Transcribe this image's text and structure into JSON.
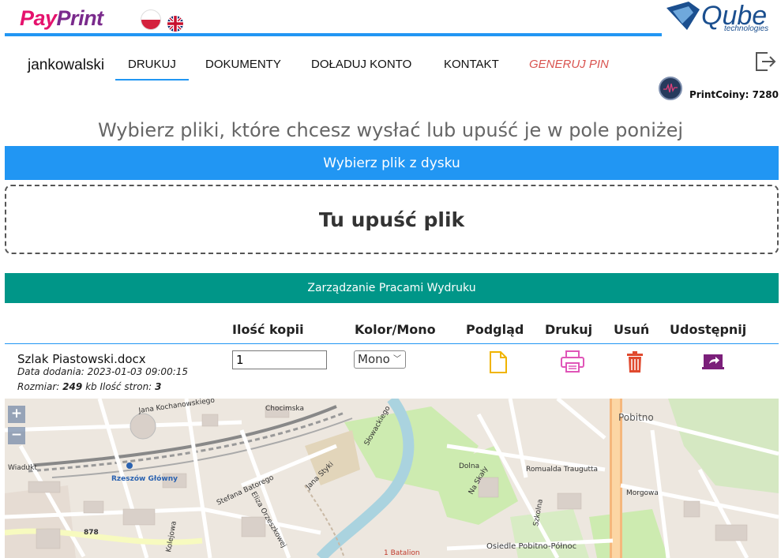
{
  "header": {
    "logo_pay": "Pay",
    "logo_print": "Print",
    "qube_name": "Qube",
    "qube_sub": "technologies"
  },
  "nav": {
    "username": "jankowalski",
    "items": [
      {
        "label": "DRUKUJ"
      },
      {
        "label": "DOKUMENTY"
      },
      {
        "label": "DOŁADUJ KONTO"
      },
      {
        "label": "KONTAKT"
      },
      {
        "label": "GENERUJ PIN"
      }
    ],
    "coins_label": "PrintCoiny: 7280"
  },
  "upload": {
    "title": "Wybierz pliki, które chcesz wysłać lub upuść je w pole poniżej",
    "choose_button": "Wybierz plik z dysku",
    "drop_text": "Tu upuść plik"
  },
  "jobs": {
    "bar_title": "Zarządzanie Pracami Wydruku",
    "columns": [
      "Ilość kopii",
      "Kolor/Mono",
      "Podgląd",
      "Drukuj",
      "Usuń",
      "Udostępnij"
    ],
    "rows": [
      {
        "file_name": "Szlak Piastowski.docx",
        "date_label": "Data dodania:",
        "date": "2023-01-03 09:00:15",
        "size_label": "Rozmiar:",
        "size": "249",
        "size_unit": "kb",
        "pages_label": "Ilość stron:",
        "pages": "3",
        "copies": "1",
        "color_mode": "Mono"
      }
    ]
  },
  "map": {
    "zoom_in": "+",
    "zoom_out": "−",
    "labels": [
      "Jana Kochanowskiego",
      "Chocimska",
      "Rzeszów Główny",
      "Wiadukt",
      "Stefana Batorego",
      "Eliza Orzeszkowej",
      "Jana Styki",
      "Dolna",
      "Romualda Traugutta",
      "Na Skały",
      "Szkolna",
      "Osiedle Pobitno-Północ",
      "Pobitno",
      "Morgowa",
      "Kolejowa",
      "878",
      "1 Batalion",
      "Słowackiego"
    ]
  },
  "colors": {
    "accent": "#2196f3",
    "manage_bar": "#009688",
    "pin": "#d9534f"
  }
}
